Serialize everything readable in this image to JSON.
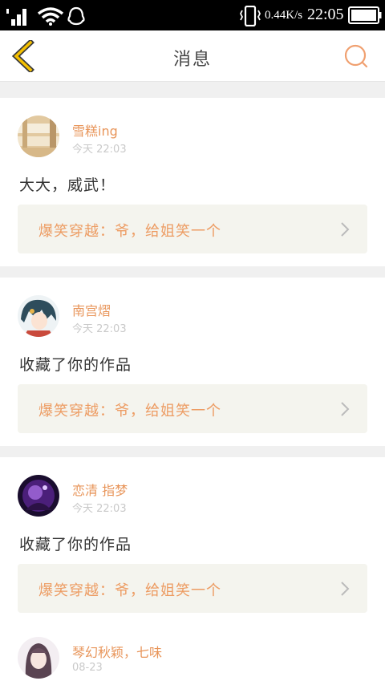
{
  "status_bar": {
    "speed": "0.44K/s",
    "time": "22:05",
    "icons": [
      "signal-icon",
      "wifi-icon",
      "qq-icon",
      "vibrate-icon",
      "battery-icon"
    ]
  },
  "nav": {
    "title": "消息",
    "back_icon": "chevron-left-icon",
    "search_icon": "search-icon"
  },
  "messages": [
    {
      "user": "雪糕ing",
      "time": "今天 22:03",
      "text": "大大，威武！",
      "work": "爆笑穿越：爷，给姐笑一个"
    },
    {
      "user": "南宫熠",
      "time": "今天 22:03",
      "text": "收藏了你的作品",
      "work": "爆笑穿越：爷，给姐笑一个"
    },
    {
      "user": "恋清 指梦",
      "time": "今天 22:03",
      "text": "收藏了你的作品",
      "work": "爆笑穿越：爷，给姐笑一个"
    },
    {
      "user": "琴幻秋颖，七味",
      "time": "08-23",
      "text": "",
      "work": ""
    }
  ],
  "colors": {
    "accent": "#e8955a",
    "nav_back": "#f5c000",
    "ref_background": "#f4f4ee"
  }
}
